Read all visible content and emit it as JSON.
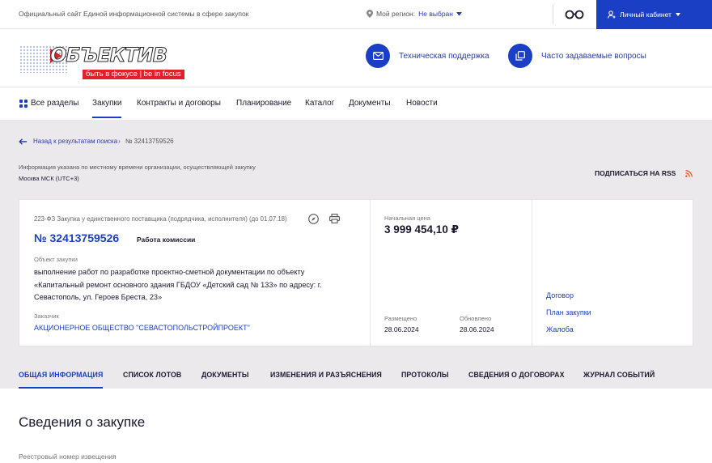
{
  "topbar": {
    "site_title": "Официальный сайт Единой информационной системы в сфере закупок",
    "region_label": "Мой регион:",
    "region_value": "Не выбран",
    "cabinet_label": "Личный кабинет"
  },
  "header": {
    "logo_text": "ОБЪЕКТИВ",
    "logo_slogan": "быть в фокусе | be in focus",
    "support_label": "Техническая поддержка",
    "faq_label": "Часто задаваемые вопросы"
  },
  "nav": {
    "items": [
      {
        "label": "Все разделы"
      },
      {
        "label": "Закупки"
      },
      {
        "label": "Контракты и договоры"
      },
      {
        "label": "Планирование"
      },
      {
        "label": "Каталог"
      },
      {
        "label": "Документы"
      },
      {
        "label": "Новости"
      }
    ]
  },
  "breadcrumb": {
    "back_label": "Назад к результатам поиска",
    "separator": "›",
    "current": "№ 32413759526"
  },
  "timezone": {
    "info": "Информация указана по местному времени организации, осуществляющей закупку",
    "value": "Москва МСК (UTC+3)"
  },
  "rss_label": "ПОДПИСАТЬСЯ НА RSS",
  "card": {
    "law": "223-ФЗ Закупка у единственного поставщика (подрядчика, исполнителя) (до 01.07.18)",
    "reg_number": "№ 32413759526",
    "status": "Работа комиссии",
    "object_label": "Объект закупки",
    "object_text": "выполнение работ по разработке проектно-сметной документации по объекту «Капитальный ремонт основного здания ГБДОУ «Детский сад № 133» по адресу: г. Севастополь, ул. Героев Бреста, 23»",
    "customer_label": "Заказчик",
    "customer_value": "АКЦИОНЕРНОЕ ОБЩЕСТВО \"СЕВАСТОПОЛЬСТРОЙПРОЕКТ\"",
    "price_label": "Начальная цена",
    "price_value": "3 999 454,10 ₽",
    "placed_label": "Размещено",
    "placed_value": "28.06.2024",
    "updated_label": "Обновлено",
    "updated_value": "28.06.2024",
    "links": [
      {
        "label": "Договор"
      },
      {
        "label": "План закупки"
      },
      {
        "label": "Жалоба"
      }
    ]
  },
  "tabs": [
    {
      "label": "ОБЩАЯ ИНФОРМАЦИЯ"
    },
    {
      "label": "СПИСОК ЛОТОВ"
    },
    {
      "label": "ДОКУМЕНТЫ"
    },
    {
      "label": "ИЗМЕНЕНИЯ И РАЗЪЯСНЕНИЯ"
    },
    {
      "label": "ПРОТОКОЛЫ"
    },
    {
      "label": "СВЕДЕНИЯ О ДОГОВОРАХ"
    },
    {
      "label": "ЖУРНАЛ СОБЫТИЙ"
    }
  ],
  "content": {
    "section_title": "Сведения о закупке",
    "field_label": "Реестровый номер извещения"
  },
  "colors": {
    "accent": "#1a3fc4",
    "link": "#2a3bb0",
    "background_gray": "#ece9ec",
    "rss": "#e85a1a",
    "logo_red": "#e0202a"
  },
  "icons": [
    "location-pin-icon",
    "glasses-icon",
    "user-icon",
    "mail-icon",
    "copy-icon",
    "grid-icon",
    "arrow-left-icon",
    "rss-icon",
    "compass-icon",
    "print-icon"
  ]
}
